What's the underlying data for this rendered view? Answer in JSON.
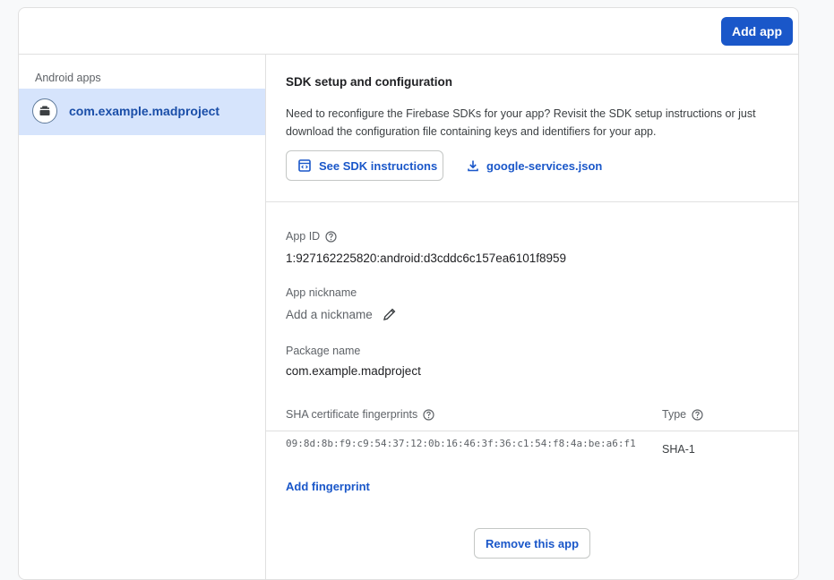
{
  "header": {
    "add_app_label": "Add app"
  },
  "sidebar": {
    "title": "Android apps",
    "items": [
      {
        "label": "com.example.madproject",
        "icon": "android-app-icon",
        "selected": true
      }
    ]
  },
  "sdk": {
    "title": "SDK setup and configuration",
    "description": "Need to reconfigure the Firebase SDKs for your app? Revisit the SDK setup instructions or just download the configuration file containing keys and identifiers for your app.",
    "see_instructions_label": "See SDK instructions",
    "download_label": "google-services.json"
  },
  "details": {
    "app_id_label": "App ID",
    "app_id_value": "1:927162225820:android:d3cddc6c157ea6101f8959",
    "nickname_label": "App nickname",
    "nickname_placeholder": "Add a nickname",
    "package_label": "Package name",
    "package_value": "com.example.madproject"
  },
  "fingerprints": {
    "header_label": "SHA certificate fingerprints",
    "type_header_label": "Type",
    "rows": [
      {
        "value": "09:8d:8b:f9:c9:54:37:12:0b:16:46:3f:36:c1:54:f8:4a:be:a6:f1",
        "type": "SHA-1"
      }
    ],
    "add_label": "Add fingerprint"
  },
  "actions": {
    "remove_label": "Remove this app"
  },
  "colors": {
    "accent": "#1a57c9",
    "selected_bg": "#d6e4fc"
  }
}
